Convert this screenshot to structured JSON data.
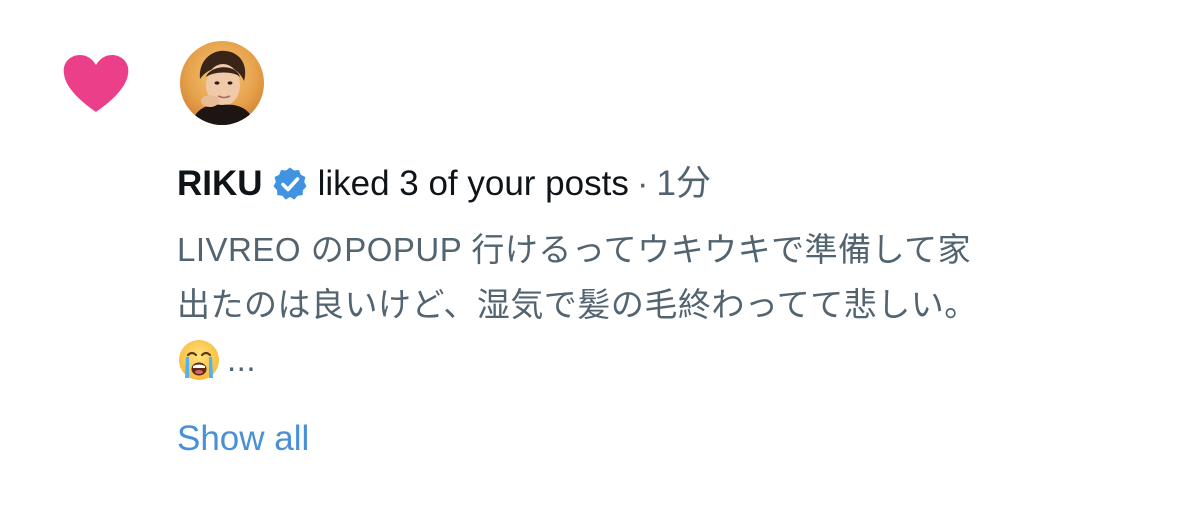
{
  "notification": {
    "type_icon": "heart-icon",
    "type_color": "#eb3f8a",
    "user": {
      "avatar_icon": "user-avatar",
      "name": "RIKU",
      "verified": true,
      "verified_icon": "verified-badge-icon",
      "verified_color": "#1d9bf0"
    },
    "action_text": "liked 3 of your posts",
    "separator": "·",
    "time": "1分",
    "post": {
      "lines": [
        "LIVREO のPOPUP 行けるってウキウキで準備して家",
        "出たのは良いけど、湿気で髪の毛終わってて悲しい。"
      ],
      "emoji_icon": "loudly-crying-face-emoji",
      "ellipsis": "..."
    },
    "show_all_label": "Show all",
    "link_color": "#4a90d6"
  }
}
